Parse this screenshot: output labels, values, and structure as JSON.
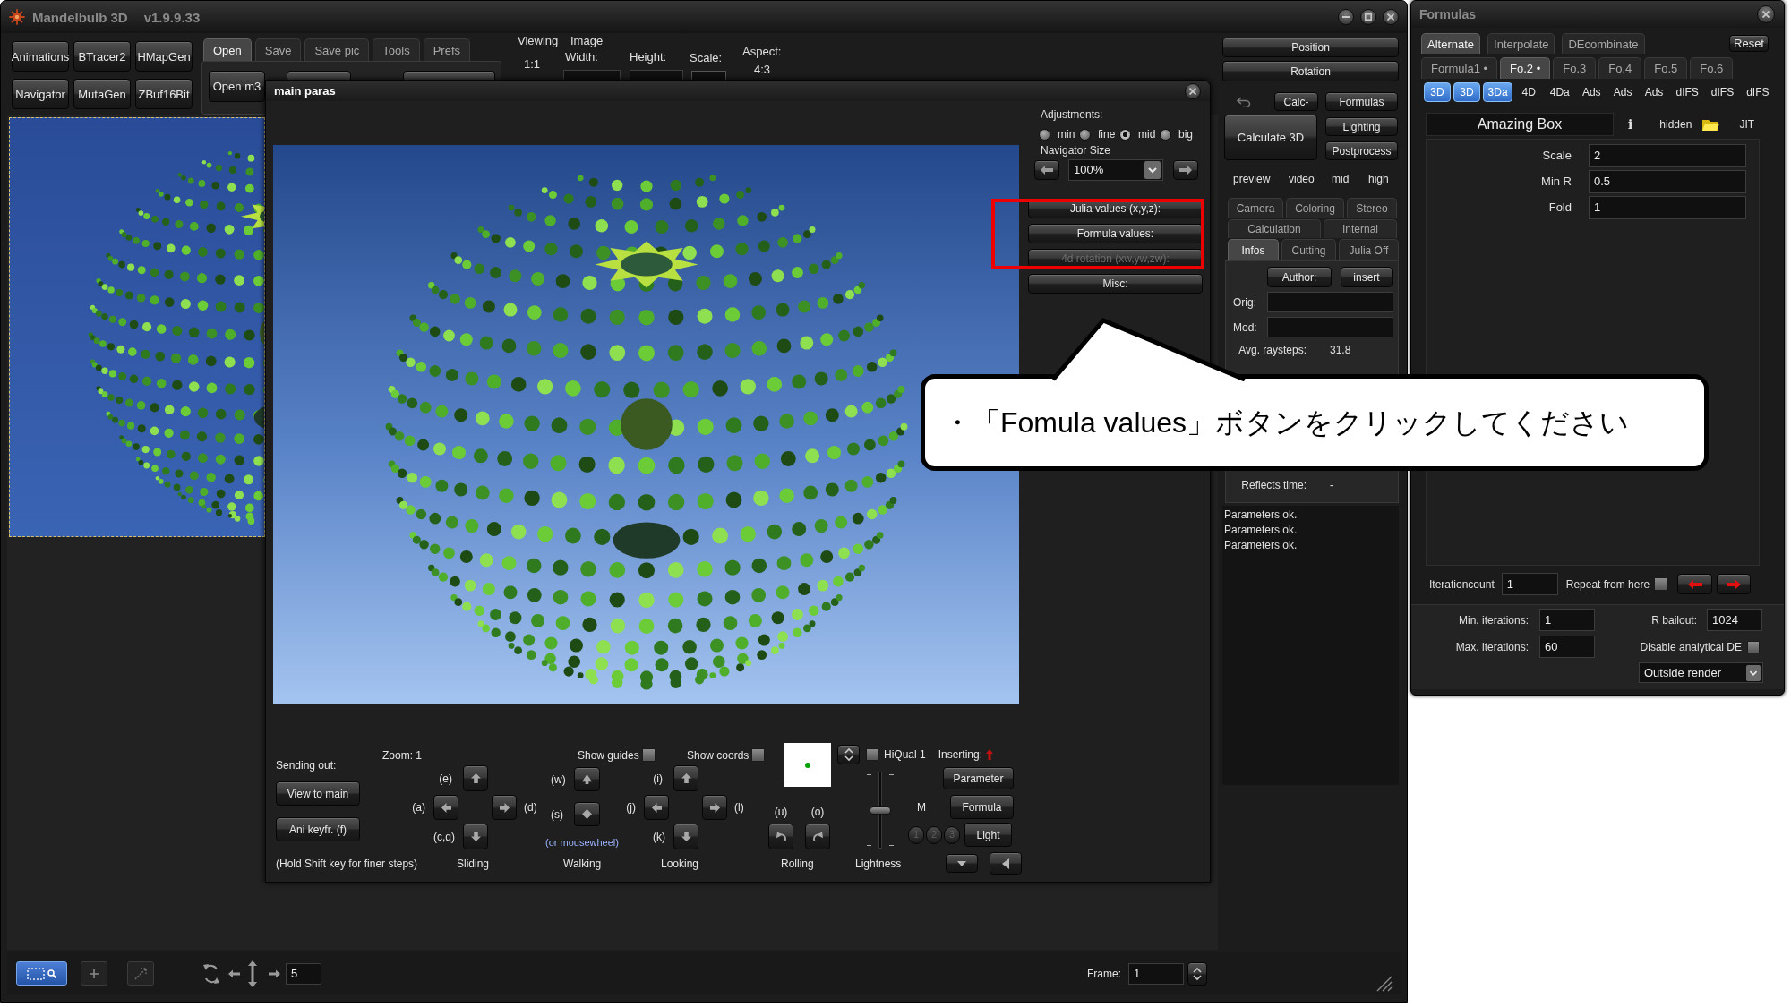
{
  "app": {
    "title": "Mandelbulb 3D",
    "version": "v1.9.9.33"
  },
  "tool_buttons": [
    "Animations",
    "BTracer2",
    "HMapGen",
    "Navigator",
    "MutaGen",
    "ZBuf16Bit"
  ],
  "file_tabs": [
    {
      "label": "Open",
      "selected": true
    },
    {
      "label": "Save",
      "selected": false
    },
    {
      "label": "Save pic",
      "selected": false
    },
    {
      "label": "Tools",
      "selected": false
    },
    {
      "label": "Prefs",
      "selected": false
    }
  ],
  "open_panel": {
    "buttons": [
      "Open m3"
    ]
  },
  "viewing": {
    "label": "Viewing",
    "value": "1:1"
  },
  "image_size": {
    "label": "Image",
    "width_label": "Width:",
    "height_label": "Height:",
    "scale_label": "Scale:",
    "aspect_label": "Aspect:",
    "aspect": "4:3"
  },
  "side_panel": {
    "position": "Position",
    "rotation": "Rotation",
    "calc_minus": "Calc-",
    "formulas": "Formulas",
    "calculate": "Calculate 3D",
    "lighting": "Lighting",
    "postprocess": "Postprocess",
    "quality": [
      "preview",
      "video",
      "mid",
      "high"
    ],
    "tab_rows": [
      {
        "tabs": [
          {
            "label": "Camera",
            "selected": false
          },
          {
            "label": "Coloring",
            "selected": false
          },
          {
            "label": "Stereo",
            "selected": false
          }
        ]
      },
      {
        "tabs": [
          {
            "label": "Calculation",
            "selected": false
          },
          {
            "label": "Internal",
            "selected": false
          }
        ]
      },
      {
        "tabs": [
          {
            "label": "Infos",
            "selected": true
          },
          {
            "label": "Cutting",
            "selected": false
          },
          {
            "label": "Julia Off",
            "selected": false
          }
        ]
      }
    ],
    "author": "Author:",
    "insert": "insert",
    "orig_label": "Orig:",
    "mod_label": "Mod:",
    "stats": [
      {
        "label": "Avg. raysteps:",
        "value": "31.8"
      },
      {
        "label": "Reflects time:",
        "value": "-"
      }
    ],
    "log": [
      "Parameters ok.",
      "Parameters ok.",
      "Parameters ok."
    ]
  },
  "bottom_bar": {
    "tools": [
      {
        "kind": "select_zoom",
        "selected": true
      },
      {
        "kind": "plus",
        "selected": false
      },
      {
        "kind": "diagonal",
        "selected": false
      }
    ],
    "step": "5",
    "frame_label": "Frame:",
    "frame": "1"
  },
  "main_paras": {
    "title": "main paras",
    "adjustments": {
      "label": "Adjustments:",
      "options": [
        {
          "label": "min",
          "selected": false
        },
        {
          "label": "fine",
          "selected": false
        },
        {
          "label": "mid",
          "selected": true
        },
        {
          "label": "big",
          "selected": false
        }
      ]
    },
    "navigator_size": {
      "label": "Navigator Size",
      "value": "100%"
    },
    "value_buttons": [
      {
        "label": "Julia values (x,y,z):",
        "disabled": false
      },
      {
        "label": "Formula values:",
        "disabled": false
      },
      {
        "label": "4d rotation (xw,yw,zw):",
        "disabled": true
      },
      {
        "label": "Misc:",
        "disabled": false
      }
    ],
    "sending_out": "Sending out:",
    "send_buttons": [
      "View to main",
      "Ani keyfr. (f)"
    ],
    "hint": "(Hold Shift key for finer steps)",
    "zoom": "Zoom: 1",
    "show_guides": {
      "label": "Show guides",
      "checked": false
    },
    "show_coords": {
      "label": "Show coords",
      "checked": false
    },
    "nav_groups": [
      {
        "kind": "keypad",
        "label": "Sliding",
        "keys": [
          {
            "label": "(e)",
            "kind": "up"
          },
          {
            "label": "(a)",
            "kind": "left"
          },
          {
            "label": "(d)",
            "kind": "right"
          },
          {
            "label": "(c,q)",
            "kind": "down"
          }
        ]
      },
      {
        "kind": "column",
        "label": "Walking",
        "keys": [
          {
            "label": "(w)",
            "kind": "forward"
          },
          {
            "label": "(s)",
            "kind": "back"
          }
        ],
        "note": "(or mousewheel)"
      },
      {
        "kind": "keypad",
        "label": "Looking",
        "keys": [
          {
            "label": "(i)",
            "kind": "up"
          },
          {
            "label": "(j)",
            "kind": "left"
          },
          {
            "label": "(l)",
            "kind": "right"
          },
          {
            "label": "(k)",
            "kind": "down"
          }
        ]
      },
      {
        "kind": "pair",
        "label": "Rolling",
        "keys": [
          {
            "label": "(u)",
            "kind": "roll_left"
          },
          {
            "label": "(o)",
            "kind": "roll_right"
          }
        ]
      }
    ],
    "hiqual": {
      "label": "HiQual 1",
      "checked": false
    },
    "lightness": {
      "label": "Lightness",
      "level": 0.5
    },
    "inserting": "Inserting:",
    "insert_buttons": [
      "Parameter",
      "Formula",
      "Light"
    ],
    "light_label": "M",
    "light_slots": [
      {
        "label": "1",
        "disabled": true
      },
      {
        "label": "2",
        "disabled": true
      },
      {
        "label": "3",
        "disabled": true
      }
    ]
  },
  "formulas": {
    "title": "Formulas",
    "mode_tabs": [
      {
        "label": "Alternate",
        "selected": true
      },
      {
        "label": "Interpolate",
        "selected": false
      },
      {
        "label": "DEcombinate",
        "selected": false
      }
    ],
    "reset": "Reset",
    "formula_tabs": [
      {
        "label": "Formula1 •",
        "selected": false
      },
      {
        "label": "Fo.2 •",
        "selected": true
      },
      {
        "label": "Fo.3",
        "selected": false
      },
      {
        "label": "Fo.4",
        "selected": false
      },
      {
        "label": "Fo.5",
        "selected": false
      },
      {
        "label": "Fo.6",
        "selected": false
      }
    ],
    "types": [
      {
        "label": "3D",
        "selected": true
      },
      {
        "label": "3D",
        "selected": true
      },
      {
        "label": "3Da",
        "selected": true
      },
      {
        "label": "4D",
        "selected": false
      },
      {
        "label": "4Da",
        "selected": false
      },
      {
        "label": "Ads",
        "selected": false
      },
      {
        "label": "Ads",
        "selected": false
      },
      {
        "label": "Ads",
        "selected": false
      },
      {
        "label": "dIFS",
        "selected": false
      },
      {
        "label": "dIFS",
        "selected": false
      },
      {
        "label": "dIFS",
        "selected": false
      }
    ],
    "name": "Amazing Box",
    "info": "i",
    "hidden": "hidden",
    "jit": "JIT",
    "params": [
      {
        "label": "Scale",
        "value": "2"
      },
      {
        "label": "Min R",
        "value": "0.5"
      },
      {
        "label": "Fold",
        "value": "1"
      }
    ],
    "iteration_count": {
      "label": "Iterationcount",
      "value": "1"
    },
    "repeat": {
      "label": "Repeat from here",
      "checked": false
    },
    "min_iterations": {
      "label": "Min. iterations:",
      "value": "1"
    },
    "max_iterations": {
      "label": "Max. iterations:",
      "value": "60"
    },
    "bailout": {
      "label": "R bailout:",
      "value": "1024"
    },
    "disable_de": {
      "label": "Disable analytical DE",
      "checked": false
    },
    "outside_render": "Outside render"
  },
  "callout": {
    "text": "・「Fomula values」ボタンをクリックしてください"
  }
}
